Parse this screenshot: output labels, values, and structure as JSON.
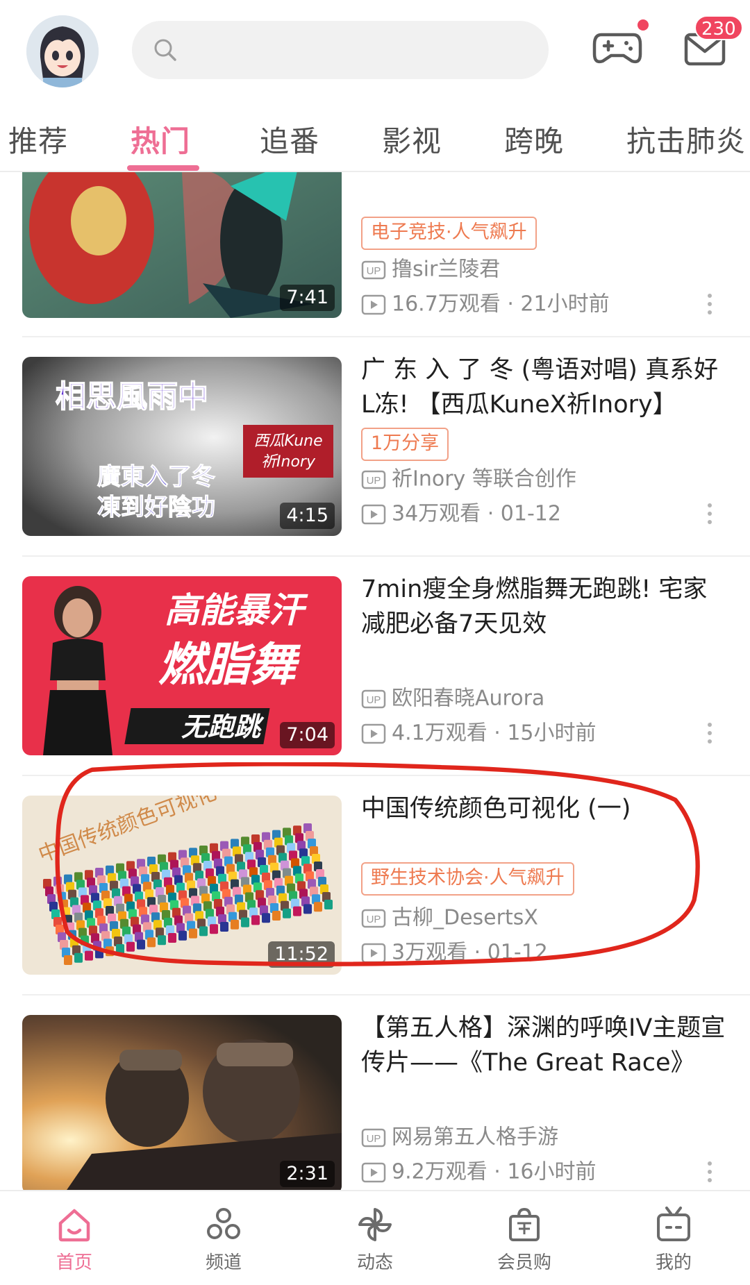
{
  "header": {
    "search_placeholder": "",
    "mail_badge": "230",
    "accent_color": "#ee6e94",
    "badge_color": "#f0455f"
  },
  "tabs": [
    {
      "label": "推荐",
      "active": false
    },
    {
      "label": "热门",
      "active": true
    },
    {
      "label": "追番",
      "active": false
    },
    {
      "label": "影视",
      "active": false
    },
    {
      "label": "跨晚",
      "active": false
    },
    {
      "label": "抗击肺炎",
      "active": false
    }
  ],
  "videos": [
    {
      "title": "",
      "tag": "电子竞技·人气飙升",
      "uploader": "撸sir兰陵君",
      "stats": "16.7万观看 · 21小时前",
      "duration": "7:41"
    },
    {
      "title": "广 东 入 了 冬 (粤语对唱) 真系好L冻! 【西瓜KuneX祈Inory】",
      "tag": "1万分享",
      "uploader": "祈Inory 等联合创作",
      "stats": "34万观看 · 01-12",
      "duration": "4:15",
      "thumb_text": [
        "相思風雨中",
        "廣東入了冬",
        "凍到好陰功",
        "西瓜Kune",
        "祈Inory"
      ]
    },
    {
      "title": "7min瘦全身燃脂舞无跑跳! 宅家减肥必备7天见效",
      "tag": "",
      "uploader": "欧阳春晓Aurora",
      "stats": "4.1万观看 · 15小时前",
      "duration": "7:04",
      "thumb_text": [
        "高能暴汗",
        "燃脂舞",
        "无跑跳"
      ]
    },
    {
      "title": "中国传统颜色可视化 (一)",
      "tag": "野生技术协会·人气飙升",
      "uploader": "古柳_DesertsX",
      "stats": "3万观看 · 01-12",
      "duration": "11:52",
      "thumb_text": [
        "中国传统颜色可视化"
      ]
    },
    {
      "title": "【第五人格】深渊的呼唤IV主题宣传片——《The Great Race》",
      "tag": "",
      "uploader": "网易第五人格手游",
      "stats": "9.2万观看 · 16小时前",
      "duration": "2:31"
    }
  ],
  "bottom_nav": [
    {
      "label": "首页",
      "icon": "home-icon",
      "active": true
    },
    {
      "label": "频道",
      "icon": "channel-icon",
      "active": false
    },
    {
      "label": "动态",
      "icon": "pinwheel-icon",
      "active": false
    },
    {
      "label": "会员购",
      "icon": "shopping-bag-icon",
      "active": false
    },
    {
      "label": "我的",
      "icon": "tv-icon",
      "active": false
    }
  ],
  "up_label": "UP"
}
